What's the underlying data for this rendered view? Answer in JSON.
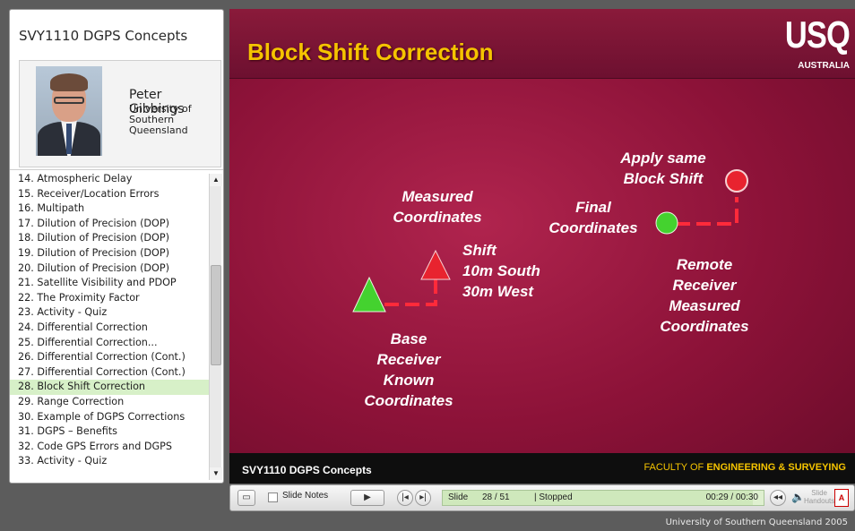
{
  "sidebar": {
    "course_title": "SVY1110 DGPS Concepts",
    "presenter_name": "Peter Gibbings",
    "presenter_org": "University of Southern Queensland",
    "outline": [
      "14. Atmospheric Delay",
      "15. Receiver/Location Errors",
      "16. Multipath",
      "17. Dilution of Precision (DOP)",
      "18. Dilution of Precision (DOP)",
      "19. Dilution of Precision (DOP)",
      "20. Dilution of Precision (DOP)",
      "21. Satellite Visibility and PDOP",
      "22. The Proximity Factor",
      "23. Activity - Quiz",
      "24. Differential Correction",
      "25. Differential Correction...",
      "26. Differential Correction (Cont.)",
      "27. Differential Correction (Cont.)",
      "28. Block Shift Correction",
      "29. Range Correction",
      "30. Example of DGPS Corrections",
      "31. DGPS – Benefits",
      "32. Code GPS Errors and DGPS",
      "33. Activity - Quiz"
    ],
    "selected_index": 14
  },
  "slide": {
    "title": "Block Shift Correction",
    "logo_text": "USQ",
    "logo_sub": "AUSTRALIA",
    "footer_left": "SVY1110 DGPS Concepts",
    "footer_right_prefix": "FACULTY OF",
    "footer_right_bold": "ENGINEERING & SURVEYING",
    "labels": {
      "measured": [
        "Measured",
        "Coordinates"
      ],
      "shift": [
        "Shift",
        "10m South",
        "30m West"
      ],
      "base": [
        "Base",
        "Receiver",
        "Known",
        "Coordinates"
      ],
      "apply": [
        "Apply same",
        "Block Shift"
      ],
      "final": [
        "Final",
        "Coordinates"
      ],
      "remote": [
        "Remote",
        "Receiver",
        "Measured",
        "Coordinates"
      ]
    },
    "colors": {
      "title": "#f5c400",
      "green_marker": "#44d22f",
      "red_marker": "#e8232f",
      "connector": "#ff2a3a"
    }
  },
  "controls": {
    "slide_notes_label": "Slide Notes",
    "slide_label": "Slide",
    "slide_position": "28 / 51",
    "status": "| Stopped",
    "time": "00:29 / 00:30",
    "progress_fraction": 0.967,
    "handouts_label_1": "Slide",
    "handouts_label_2": "Handouts"
  },
  "copyright": "University of Southern Queensland 2005"
}
